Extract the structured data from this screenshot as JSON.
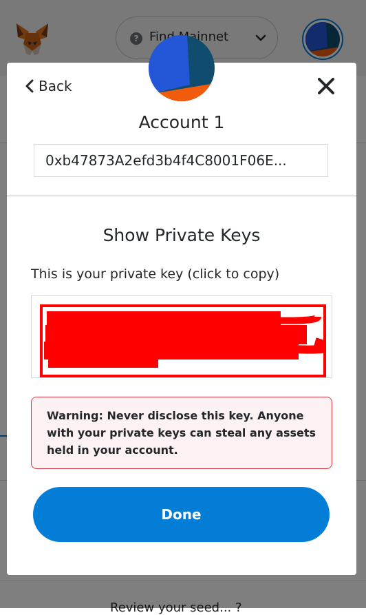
{
  "background": {
    "network": {
      "label": "Find Mainnet",
      "help_icon": "question-circle-icon",
      "chevron_icon": "chevron-down-icon"
    },
    "logo_icon": "metamask-fox-icon",
    "bottom_text": "Review your seed... ?"
  },
  "modal": {
    "back_label": "Back",
    "back_icon": "chevron-left-icon",
    "close_icon": "close-icon",
    "account_name": "Account 1",
    "address": "0xb47873A2efd3b4f4C8001F06E...",
    "section_title": "Show Private Keys",
    "copy_label": "This is your private key (click to copy)",
    "warning_text": "Warning: Never disclose this key. Anyone with your private keys can steal any assets held in your account.",
    "done_label": "Done"
  },
  "colors": {
    "accent": "#037dd6",
    "warning_border": "#d73a49",
    "warning_bg": "#fcf2f3",
    "redaction": "#ff0000"
  }
}
